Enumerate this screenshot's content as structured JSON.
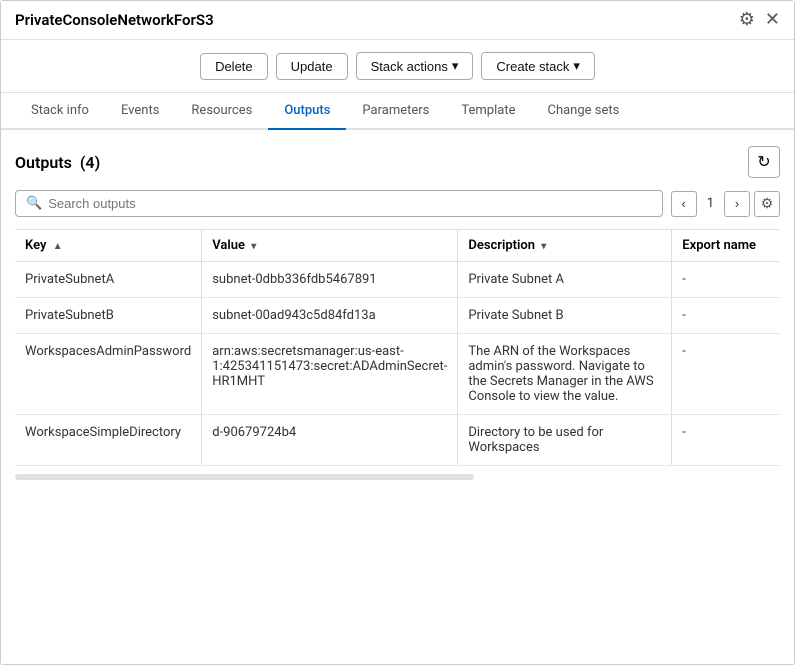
{
  "window": {
    "title": "PrivateConsoleNetworkForS3"
  },
  "toolbar": {
    "delete_label": "Delete",
    "update_label": "Update",
    "stack_actions_label": "Stack actions",
    "create_stack_label": "Create stack"
  },
  "tabs": [
    {
      "id": "stack-info",
      "label": "Stack info",
      "active": false
    },
    {
      "id": "events",
      "label": "Events",
      "active": false
    },
    {
      "id": "resources",
      "label": "Resources",
      "active": false
    },
    {
      "id": "outputs",
      "label": "Outputs",
      "active": true
    },
    {
      "id": "parameters",
      "label": "Parameters",
      "active": false
    },
    {
      "id": "template",
      "label": "Template",
      "active": false
    },
    {
      "id": "change-sets",
      "label": "Change sets",
      "active": false
    }
  ],
  "outputs_section": {
    "title": "Outputs",
    "count": "(4)",
    "search_placeholder": "Search outputs",
    "page_current": "1",
    "columns": [
      {
        "id": "key",
        "label": "Key",
        "sort": "asc"
      },
      {
        "id": "value",
        "label": "Value",
        "sort": "desc"
      },
      {
        "id": "description",
        "label": "Description",
        "sort": "desc"
      },
      {
        "id": "export_name",
        "label": "Export name",
        "sort": null
      }
    ],
    "rows": [
      {
        "key": "PrivateSubnetA",
        "value": "subnet-0dbb336fdb5467891",
        "description": "Private Subnet A",
        "export_name": "-"
      },
      {
        "key": "PrivateSubnetB",
        "value": "subnet-00ad943c5d84fd13a",
        "description": "Private Subnet B",
        "export_name": "-"
      },
      {
        "key": "WorkspacesAdminPassword",
        "value": "arn:aws:secretsmanager:us-east-1:425341151473:secret:ADAdminSecret-HR1MHT",
        "description": "The ARN of the Workspaces admin's password. Navigate to the Secrets Manager in the AWS Console to view the value.",
        "export_name": "-"
      },
      {
        "key": "WorkspaceSimpleDirectory",
        "value": "d-90679724b4",
        "description": "Directory to be used for Workspaces",
        "export_name": "-"
      }
    ]
  },
  "icons": {
    "gear": "⚙",
    "close": "✕",
    "refresh": "↻",
    "search": "🔍",
    "chevron_down": "▾",
    "chevron_left": "‹",
    "chevron_right": "›",
    "sort_asc": "▲",
    "sort_desc": "▾"
  }
}
